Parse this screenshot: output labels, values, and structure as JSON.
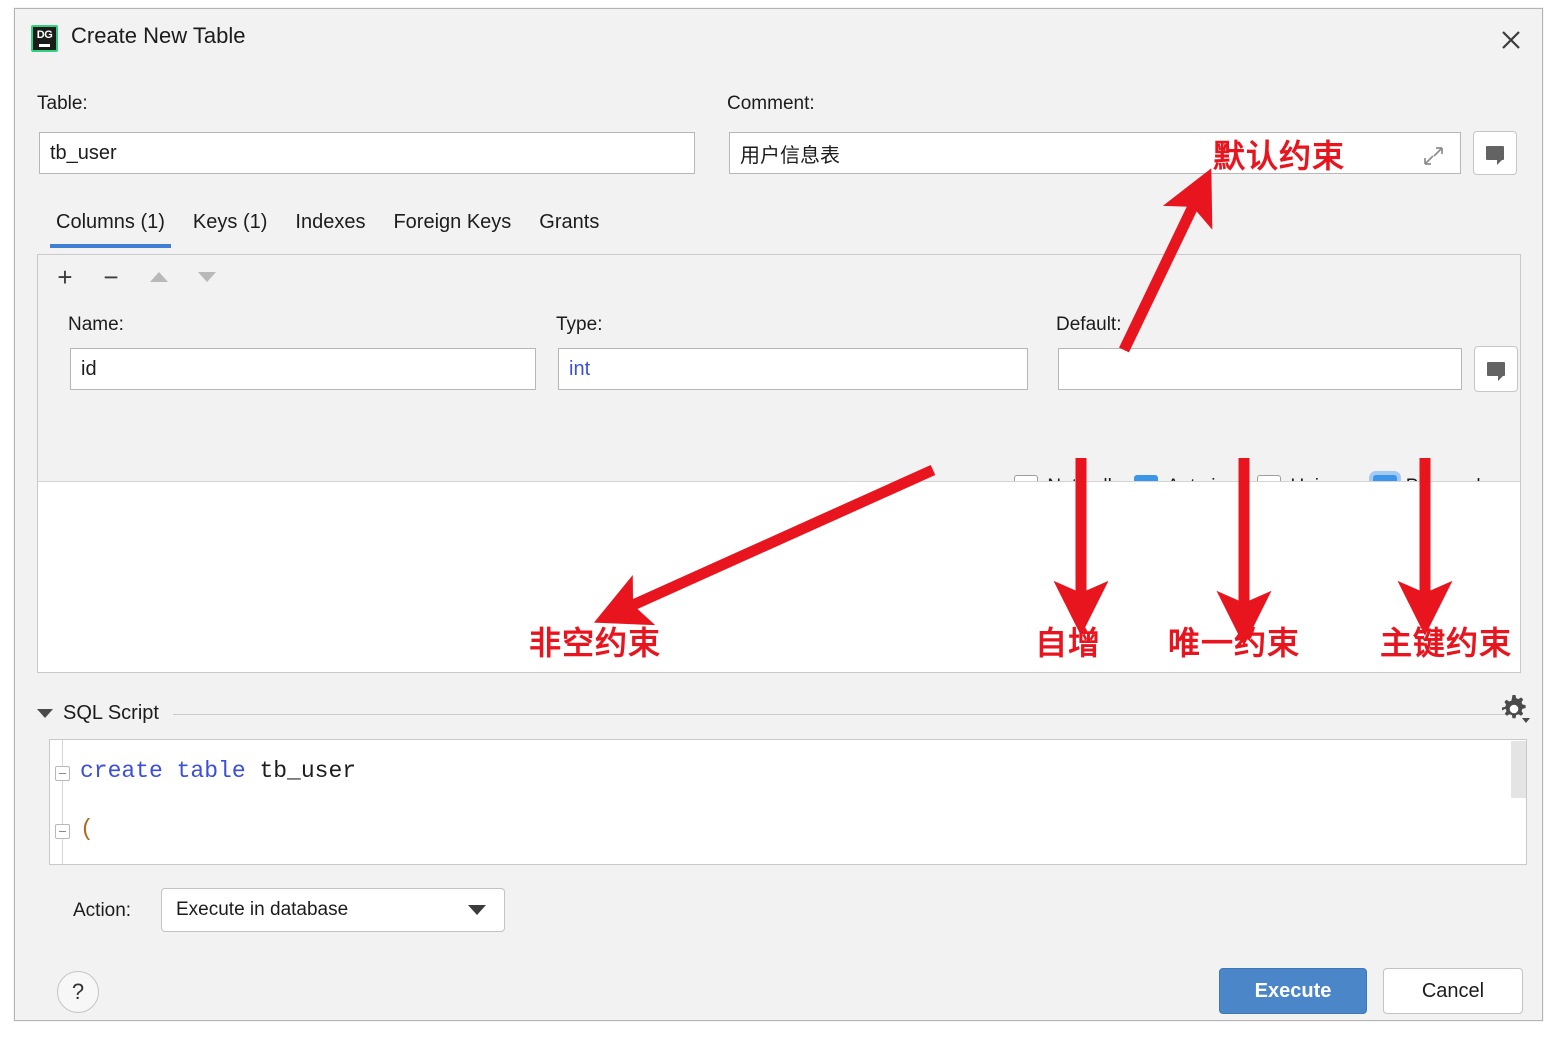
{
  "window": {
    "app_icon": "datagrip-icon",
    "title": "Create New Table",
    "close_icon": "close-icon"
  },
  "table_field": {
    "label": "Table:",
    "value": "tb_user",
    "placeholder": ""
  },
  "comment_field": {
    "label": "Comment:",
    "value": "用户信息表",
    "placeholder": "",
    "expand_icon": "expand-icon",
    "comment_button_icon": "comment-bubble-icon"
  },
  "tabs": [
    {
      "label": "Columns (1)",
      "active": true
    },
    {
      "label": "Keys (1)",
      "active": false
    },
    {
      "label": "Indexes",
      "active": false
    },
    {
      "label": "Foreign Keys",
      "active": false
    },
    {
      "label": "Grants",
      "active": false
    }
  ],
  "columns_toolbar": [
    {
      "name": "add-column-button",
      "glyph": "+",
      "enabled": true
    },
    {
      "name": "remove-column-button",
      "glyph": "–",
      "enabled": true
    },
    {
      "name": "move-up-button",
      "glyph": "triangle-up",
      "enabled": false
    },
    {
      "name": "move-down-button",
      "glyph": "triangle-down",
      "enabled": false
    }
  ],
  "column_editor": {
    "name_label": "Name:",
    "name_value": "id",
    "type_label": "Type:",
    "type_value": "int",
    "default_label": "Default:",
    "default_value": "",
    "default_comment_button_icon": "comment-bubble-icon"
  },
  "column_flags": [
    {
      "label": "Not null",
      "checked": false,
      "focused": false
    },
    {
      "label": "Auto inc",
      "checked": true,
      "focused": false
    },
    {
      "label": "Unique",
      "checked": false,
      "focused": false
    },
    {
      "label": "Primary key",
      "checked": true,
      "focused": true
    }
  ],
  "sql_section": {
    "title": "SQL Script",
    "collapse_icon": "triangle-down-icon",
    "settings_icon": "gear-icon",
    "lines": [
      {
        "tokens": [
          {
            "text": "create table ",
            "cls": "kw"
          },
          {
            "text": "tb_user",
            "cls": "pl"
          }
        ]
      },
      {
        "tokens": [
          {
            "text": "(",
            "cls": "pn"
          }
        ]
      }
    ],
    "line1_keyword": "create table ",
    "line1_name": "tb_user",
    "line2_paren": "("
  },
  "action_row": {
    "label": "Action:",
    "value": "Execute in database",
    "caret_icon": "chevron-down-icon"
  },
  "footer": {
    "help_label": "?",
    "execute_label": "Execute",
    "cancel_label": "Cancel"
  },
  "annotations": [
    {
      "name": "annotation-default-constraint",
      "text": "默认约束"
    },
    {
      "name": "annotation-not-null-constraint",
      "text": "非空约束"
    },
    {
      "name": "annotation-auto-increment",
      "text": "自增"
    },
    {
      "name": "annotation-unique-constraint",
      "text": "唯一约束"
    },
    {
      "name": "annotation-primary-key-constraint",
      "text": "主键约束"
    }
  ],
  "background_bleed_text": "",
  "colors": {
    "accent_blue": "#3b95e8",
    "tab_underline": "#3f7fd4",
    "execute_button": "#4a86c8",
    "annotation_red": "#e8151f",
    "sql_keyword": "#3b4fd8",
    "sql_paren": "#b06a1e",
    "type_value": "#3b4fd8",
    "dialog_bg": "#f2f2f2"
  }
}
